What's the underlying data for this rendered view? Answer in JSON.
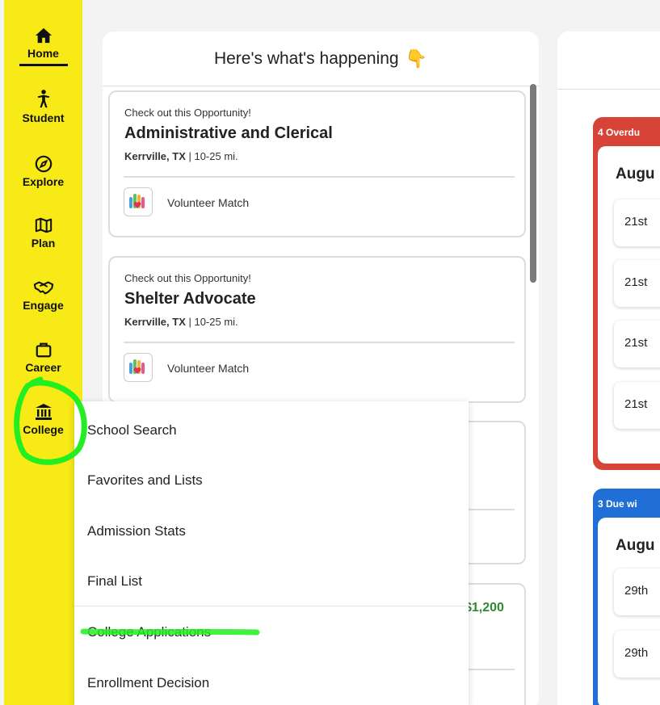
{
  "sidebar": {
    "items": [
      {
        "label": "Home",
        "icon": "home-icon"
      },
      {
        "label": "Student",
        "icon": "student-icon"
      },
      {
        "label": "Explore",
        "icon": "compass-icon"
      },
      {
        "label": "Plan",
        "icon": "map-icon"
      },
      {
        "label": "Engage",
        "icon": "handshake-icon"
      },
      {
        "label": "Career",
        "icon": "briefcase-icon"
      },
      {
        "label": "College",
        "icon": "institution-icon"
      }
    ]
  },
  "happening": {
    "title": "Here's what's happening",
    "emoji": "👇",
    "opportunities": [
      {
        "kicker": "Check out this Opportunity!",
        "title": "Administrative and Clerical",
        "city": "Kerrville, TX",
        "distance": " | 10-25 mi.",
        "org": "Volunteer Match"
      },
      {
        "kicker": "Check out this Opportunity!",
        "title": "Shelter Advocate",
        "city": "Kerrville, TX",
        "distance": " | 10-25 mi.",
        "org": "Volunteer Match"
      }
    ],
    "partial_amount": "$1,200"
  },
  "college_menu": {
    "items": [
      "School Search",
      "Favorites and Lists",
      "Admission Stats",
      "Final List",
      "College Applications",
      "Enrollment Decision"
    ]
  },
  "due": {
    "overdue": {
      "tag": "4 Overdu",
      "month": "Augu",
      "days": [
        "21st",
        "21st",
        "21st",
        "21st"
      ]
    },
    "upcoming": {
      "tag": "3 Due wi",
      "month": "Augu",
      "days": [
        "29th",
        "29th"
      ]
    }
  },
  "colors": {
    "sidebar": "#f7ea16",
    "overdue": "#d84337",
    "upcoming": "#1f6fd6",
    "annotation": "#22ee22",
    "money": "#2f8a2f"
  }
}
